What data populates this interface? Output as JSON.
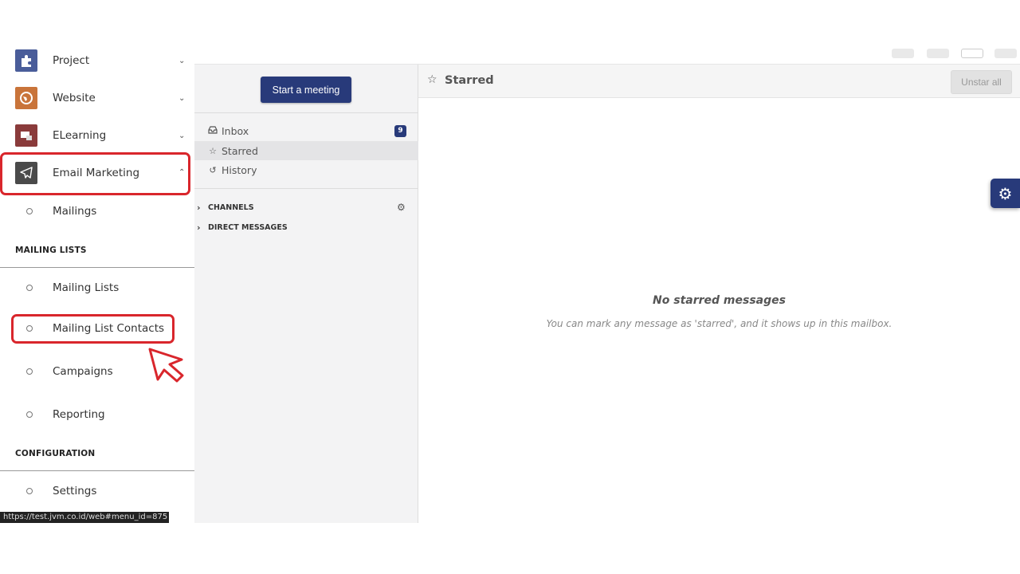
{
  "apps": [
    {
      "label": "Project"
    },
    {
      "label": "Website"
    },
    {
      "label": "ELearning"
    },
    {
      "label": "Email Marketing"
    }
  ],
  "email_marketing": {
    "mailings_label": "Mailings",
    "mailing_lists_header": "MAILING LISTS",
    "mailing_lists_label": "Mailing Lists",
    "mailing_list_contacts_label": "Mailing List Contacts",
    "campaigns_label": "Campaigns",
    "reporting_label": "Reporting",
    "configuration_header": "CONFIGURATION",
    "settings_label": "Settings"
  },
  "status_url": "https://test.jvm.co.id/web#menu_id=875",
  "discuss": {
    "start_meeting": "Start a meeting",
    "mailboxes": [
      {
        "label": "Inbox",
        "counter": "9"
      },
      {
        "label": "Starred"
      },
      {
        "label": "History"
      }
    ],
    "categories": [
      {
        "label": "CHANNELS"
      },
      {
        "label": "DIRECT MESSAGES"
      }
    ]
  },
  "thread": {
    "title": "Starred",
    "unstar_all": "Unstar all",
    "empty_title": "No starred messages",
    "empty_hint": "You can mark any message as 'starred', and it shows up in this mailbox."
  },
  "colors": {
    "accent": "#283a7a",
    "highlight": "#d9262c"
  }
}
